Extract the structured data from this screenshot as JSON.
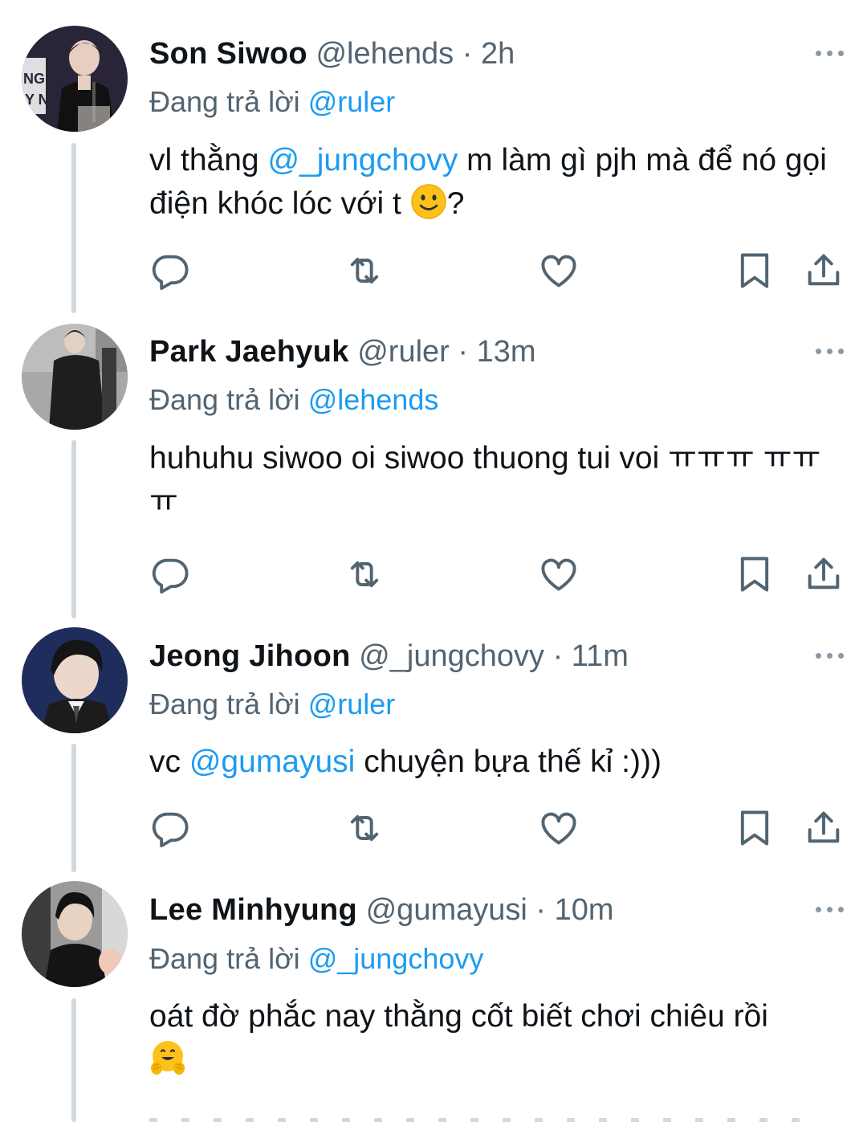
{
  "tweets": [
    {
      "name": "Son Siwoo",
      "handle": "@lehends",
      "sep": "·",
      "time": "2h",
      "reply_prefix": "Đang trả lời",
      "reply_to": "@ruler",
      "body_parts": [
        "vl thằng ",
        "@_jungchovy",
        " m làm gì pjh mà để nó gọi điện khóc lóc với t ",
        "?"
      ],
      "avatar": "avatar-son-siwoo"
    },
    {
      "name": "Park Jaehyuk",
      "handle": "@ruler",
      "sep": "·",
      "time": "13m",
      "reply_prefix": "Đang trả lời",
      "reply_to": "@lehends",
      "body_parts": [
        "huhuhu siwoo oi siwoo thuong tui voi ㅠㅠㅠ ㅠㅠㅠ"
      ],
      "avatar": "avatar-park-jaehyuk"
    },
    {
      "name": "Jeong Jihoon",
      "handle": "@_jungchovy",
      "sep": "·",
      "time": "11m",
      "reply_prefix": "Đang trả lời",
      "reply_to": "@ruler",
      "body_parts": [
        "vc ",
        "@gumayusi",
        " chuyện bựa thế kỉ :)))"
      ],
      "avatar": "avatar-jeong-jihoon"
    },
    {
      "name": "Lee Minhyung",
      "handle": "@gumayusi",
      "sep": "·",
      "time": "10m",
      "reply_prefix": "Đang trả lời",
      "reply_to": "@_jungchovy",
      "body_parts": [
        "oát đờ phắc nay thằng cốt biết chơi chiêu rồi"
      ],
      "avatar": "avatar-lee-minhyung"
    }
  ],
  "action_icons": [
    "reply-icon",
    "retweet-icon",
    "like-icon",
    "bookmark-icon",
    "share-icon"
  ],
  "colors": {
    "mention": "#1d9bf0",
    "secondary": "#536471",
    "icon": "#536471",
    "thread_line": "#cfd9de"
  }
}
